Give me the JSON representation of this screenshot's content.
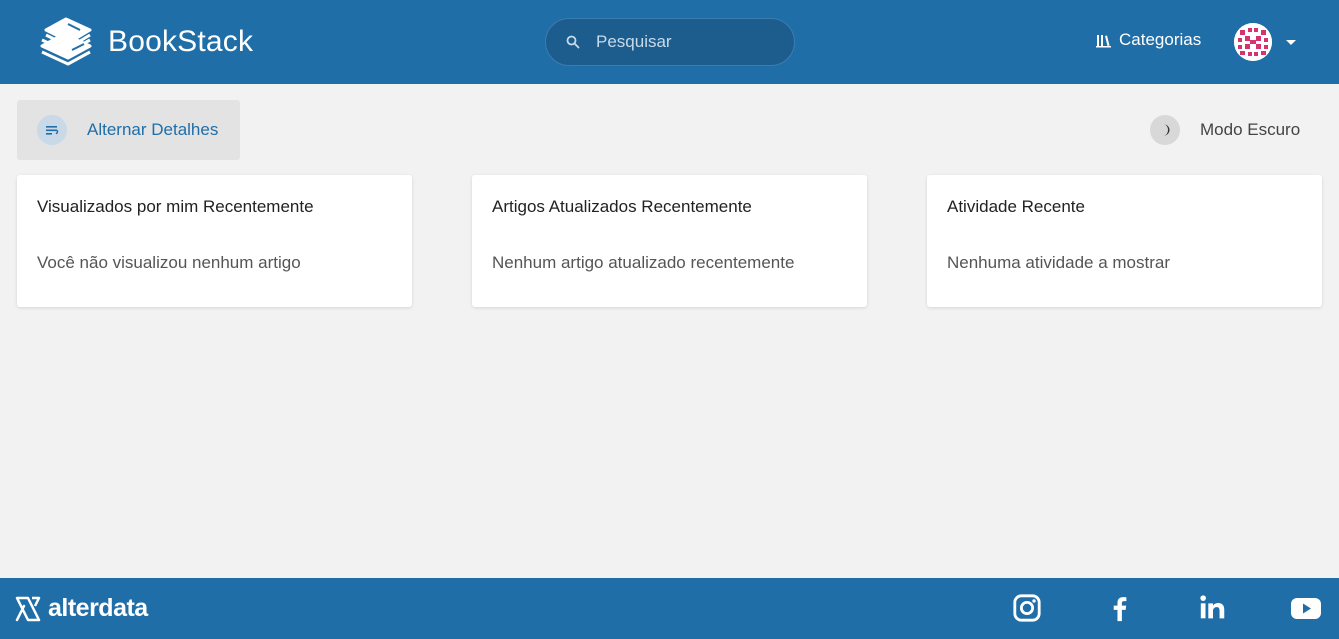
{
  "header": {
    "app_name": "BookStack",
    "search_placeholder": "Pesquisar",
    "categories_label": "Categorias"
  },
  "toolbar": {
    "toggle_details_label": "Alternar Detalhes",
    "dark_mode_label": "Modo Escuro"
  },
  "cards": [
    {
      "title": "Visualizados por mim Recentemente",
      "empty_text": "Você não visualizou nenhum artigo"
    },
    {
      "title": "Artigos Atualizados Recentemente",
      "empty_text": "Nenhum artigo atualizado recentemente"
    },
    {
      "title": "Atividade Recente",
      "empty_text": "Nenhuma atividade a mostrar"
    }
  ],
  "footer": {
    "brand_text": "alterdata",
    "social_icons": [
      "instagram-icon",
      "facebook-icon",
      "linkedin-icon",
      "youtube-icon"
    ]
  },
  "colors": {
    "primary": "#206ea7",
    "background": "#f2f2f2",
    "card": "#ffffff"
  }
}
